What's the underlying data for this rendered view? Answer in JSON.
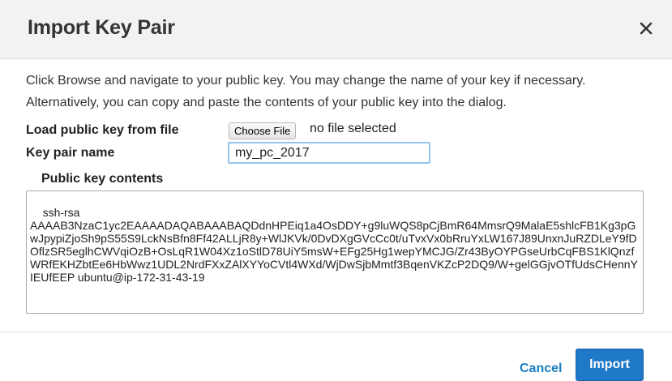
{
  "dialog": {
    "title": "Import Key Pair",
    "close_icon": "close-icon",
    "description": "Click Browse and navigate to your public key. You may change the name of your key if necessary. Alternatively, you can copy and paste the contents of your public key into the dialog."
  },
  "form": {
    "load_key_label": "Load public key from file",
    "choose_file_label": "Choose File",
    "file_status": "no file selected",
    "key_name_label": "Key pair name",
    "key_name_value": "my_pc_2017",
    "public_key_label": "Public key contents",
    "public_key_value": "ssh-rsa\nAAAAB3NzaC1yc2EAAAADAQABAAABAQDdnHPEiq1a4OsDDY+g9luWQS8pCjBmR64MmsrQ9MalaE5shlcFB1Kg3pGwJpypiZjoSh9pS55S9LckNsBfn8Ff42ALLjR8y+WlJKVk/0DvDXgGVcCc0t/uTvxVx0bRruYxLW167J89UnxnJuRZDLeY9fDOflzSR5eglhCWVqiOzB+OsLqR1W04Xz1oStlD78UiY5msW+EFg25Hg1wepYMCJG/Zr43ByOYPGseUrbCqFBS1KlQnzfWRfEKHZbtEe6HbWwz1UDL2NrdFXxZAlXYYoCVtl4WXd/WjDwSjbMmtf3BqenVKZcP2DQ9/W+gelGGjvOTfUdsCHennYIEUfEEP ubuntu@ip-172-31-43-19"
  },
  "footer": {
    "cancel_label": "Cancel",
    "import_label": "Import"
  },
  "colors": {
    "header_bg": "#f2f2f2",
    "link": "#1a7fc1",
    "primary_button": "#1f78c8",
    "input_focus_border": "#93c4ed"
  }
}
